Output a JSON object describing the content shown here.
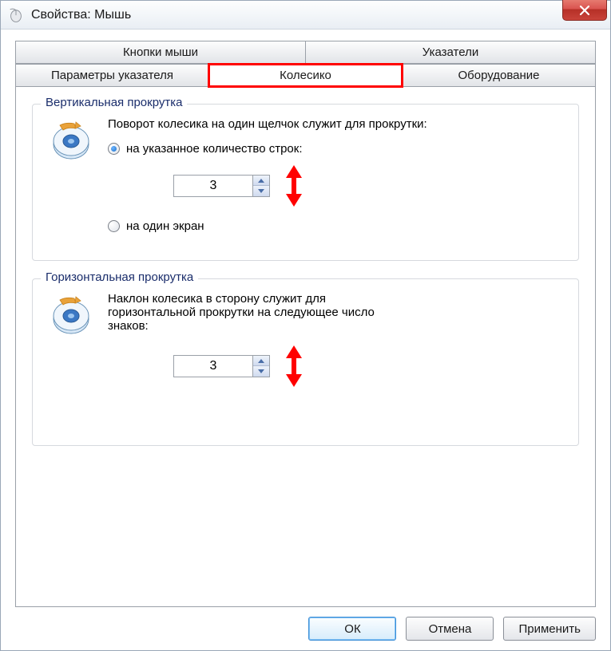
{
  "window": {
    "title": "Свойства: Мышь"
  },
  "tabs": {
    "row1": [
      "Кнопки мыши",
      "Указатели"
    ],
    "row2": [
      "Параметры указателя",
      "Колесико",
      "Оборудование"
    ],
    "active": "Колесико"
  },
  "vertical": {
    "legend": "Вертикальная прокрутка",
    "desc": "Поворот колесика на один щелчок служит для прокрутки:",
    "radio1": "на указанное количество строк:",
    "radio2": "на один экран",
    "value": "3"
  },
  "horizontal": {
    "legend": "Горизонтальная прокрутка",
    "desc": "Наклон колесика в сторону служит для горизонтальной прокрутки на следующее число знаков:",
    "value": "3"
  },
  "buttons": {
    "ok": "ОК",
    "cancel": "Отмена",
    "apply": "Применить"
  }
}
